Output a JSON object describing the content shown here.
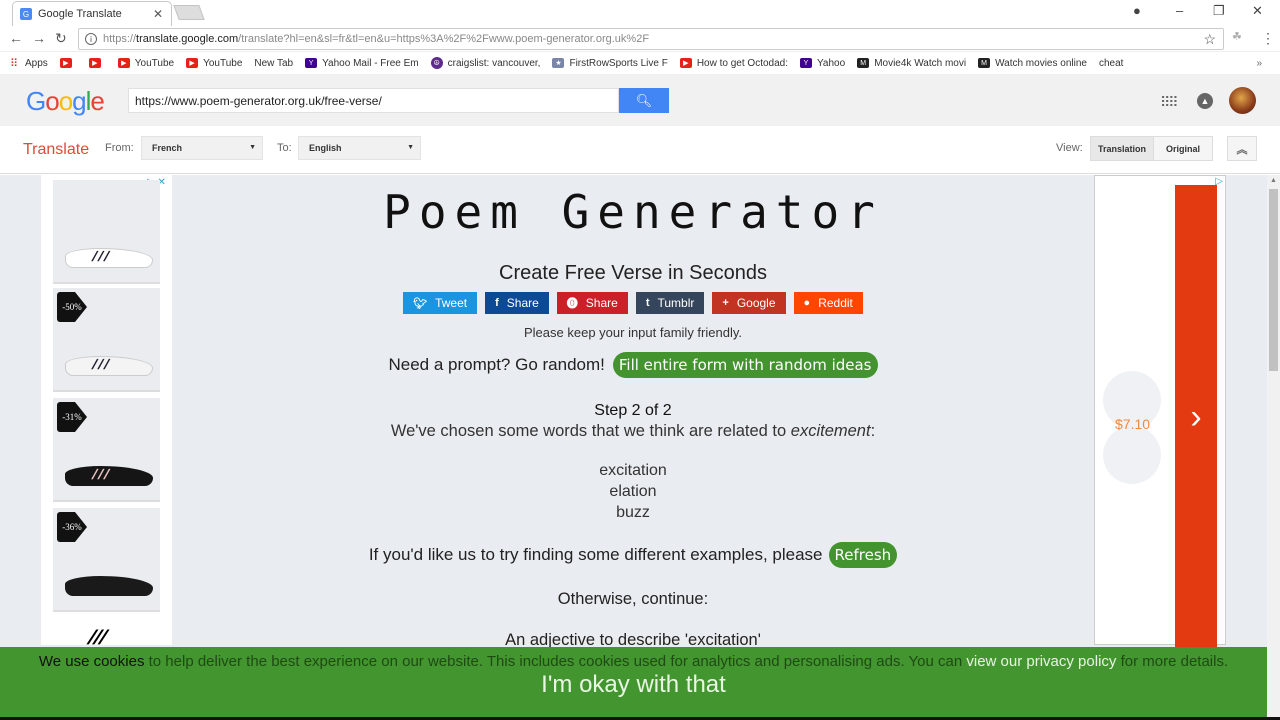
{
  "browser": {
    "tab_title": "Google Translate",
    "url_prefix": "https://",
    "url_domain": "translate.google.com",
    "url_rest": "/translate?hl=en&sl=fr&tl=en&u=https%3A%2F%2Fwww.poem-generator.org.uk%2F",
    "bookmarks": [
      {
        "label": "Apps",
        "icon": "apps"
      },
      {
        "label": "",
        "icon": "yt"
      },
      {
        "label": "",
        "icon": "yt"
      },
      {
        "label": "YouTube",
        "icon": "yt"
      },
      {
        "label": "YouTube",
        "icon": "yt"
      },
      {
        "label": "New Tab",
        "icon": "page"
      },
      {
        "label": "Yahoo Mail - Free Em",
        "icon": "yahoo"
      },
      {
        "label": "craigslist: vancouver,",
        "icon": "peace"
      },
      {
        "label": "FirstRowSports Live F",
        "icon": "frs"
      },
      {
        "label": "How to get Octodad:",
        "icon": "yt"
      },
      {
        "label": "Yahoo",
        "icon": "yahoo"
      },
      {
        "label": "Movie4k Watch movi",
        "icon": "m"
      },
      {
        "label": "Watch movies online",
        "icon": "m"
      },
      {
        "label": "cheat",
        "icon": "page"
      }
    ],
    "more_bookmarks": "»"
  },
  "google": {
    "logo": [
      "G",
      "o",
      "o",
      "g",
      "l",
      "e"
    ],
    "logo_colors": [
      "#4285f4",
      "#ea4335",
      "#fbbc05",
      "#4285f4",
      "#34a853",
      "#ea4335"
    ],
    "search_value": "https://www.poem-generator.org.uk/free-verse/"
  },
  "translate": {
    "label": "Translate",
    "from_label": "From:",
    "from_value": "French",
    "to_label": "To:",
    "to_value": "English",
    "view_label": "View:",
    "view_translation": "Translation",
    "view_original": "Original"
  },
  "ads": {
    "left_tags": [
      "",
      "-50%",
      "-31%",
      "-36%"
    ],
    "right_price": "$7.10"
  },
  "poem": {
    "title": "Poem Generator",
    "subtitle": "Create Free Verse in Seconds",
    "share_buttons": [
      {
        "label": "Tweet",
        "icon": "twitter",
        "color": "#1b95e0"
      },
      {
        "label": "Share",
        "icon": "facebook",
        "color": "#0d4a96"
      },
      {
        "label": "Share",
        "icon": "pinterest",
        "color": "#cb2027"
      },
      {
        "label": "Tumblr",
        "icon": "tumblr",
        "color": "#35465c"
      },
      {
        "label": "Google",
        "icon": "google-plus",
        "color": "#c23321"
      },
      {
        "label": "Reddit",
        "icon": "reddit",
        "color": "#ff4500"
      }
    ],
    "friendly_note": "Please keep your input family friendly.",
    "prompt_text": "Need a prompt? Go random!",
    "random_button": "Fill entire form with random ideas",
    "step": "Step 2 of 2",
    "chosen_text": "We've chosen some words that we think are related to ",
    "chosen_word": "excitement",
    "chosen_end": ":",
    "words": [
      "excitation",
      "elation",
      "buzz"
    ],
    "refresh_text": "If you'd like us to try finding some different examples, please",
    "refresh_button": "Refresh",
    "otherwise": "Otherwise, continue:",
    "adjective_question": "An adjective to describe 'excitation'"
  },
  "cookie": {
    "bold": "We use cookies",
    "text": " to help deliver the best experience on our website. This includes cookies used for analytics and personalising ads. You can ",
    "link": "view our privacy policy",
    "end": " for more details.",
    "accept": "I'm okay with that"
  }
}
